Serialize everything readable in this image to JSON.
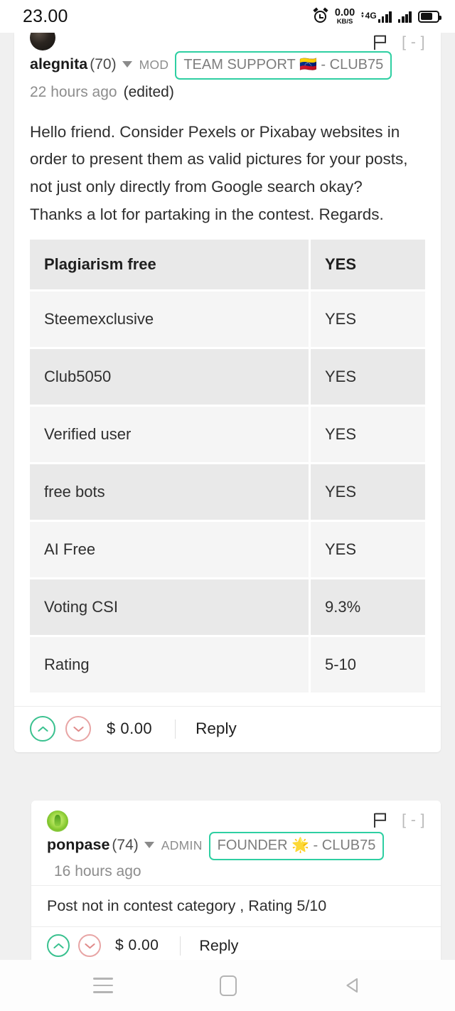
{
  "status_bar": {
    "clock": "23.00",
    "alarm_icon": "alarm-clock-icon",
    "data_rate_value": "0.00",
    "data_rate_unit": "KB/S",
    "network_type": "4G",
    "sim1_signal_icon": "signal-bars-icon",
    "sim2_signal_icon": "signal-bars-icon",
    "battery_icon": "battery-icon"
  },
  "comments": [
    {
      "avatar_name": "user-avatar-alegnita",
      "author": "alegnita",
      "reputation": "(70)",
      "role": "MOD",
      "badge": "TEAM SUPPORT 🇻🇪 - CLUB75",
      "timestamp": "22 hours ago",
      "edited": "(edited)",
      "flag_icon": "flag-icon",
      "collapse_label": "[ - ]",
      "body_lines": [
        "Hello friend. Consider Pexels or Pixabay websites in",
        "order to present them as valid pictures for your posts,",
        "not just only directly from Google search okay?",
        "Thanks a lot for partaking in the contest. Regards."
      ],
      "table": [
        {
          "key": "Plagiarism free",
          "value": "YES"
        },
        {
          "key": "Steemexclusive",
          "value": "YES"
        },
        {
          "key": "Club5050",
          "value": "YES"
        },
        {
          "key": "Verified user",
          "value": "YES"
        },
        {
          "key": "free bots",
          "value": "YES"
        },
        {
          "key": "AI Free",
          "value": "YES"
        },
        {
          "key": "Voting CSI",
          "value": "9.3%"
        },
        {
          "key": "Rating",
          "value": "5-10"
        }
      ],
      "upvote_icon": "chevron-up-icon",
      "downvote_icon": "chevron-down-icon",
      "payout": "$ 0.00",
      "reply_label": "Reply"
    },
    {
      "avatar_name": "user-avatar-ponpase",
      "author": "ponpase",
      "reputation": "(74)",
      "role": "ADMIN",
      "badge": "FOUNDER 🌟 - CLUB75",
      "timestamp": "16 hours ago",
      "flag_icon": "flag-icon",
      "collapse_label": "[ - ]",
      "body": "Post not in contest category , Rating 5/10",
      "upvote_icon": "chevron-up-icon",
      "downvote_icon": "chevron-down-icon",
      "payout": "$ 0.00",
      "reply_label": "Reply"
    }
  ],
  "nav_bar": {
    "recents_icon": "recents-menu-icon",
    "home_icon": "home-square-icon",
    "back_icon": "back-triangle-icon"
  },
  "colors": {
    "badge_border": "#2ecfa2",
    "upvote": "#3ac18f",
    "downvote": "#e8a5a5",
    "page_background": "#f0f0f0",
    "card_background": "#ffffff",
    "table_row_dark": "#e9e9e9",
    "table_row_light": "#f5f5f5"
  }
}
